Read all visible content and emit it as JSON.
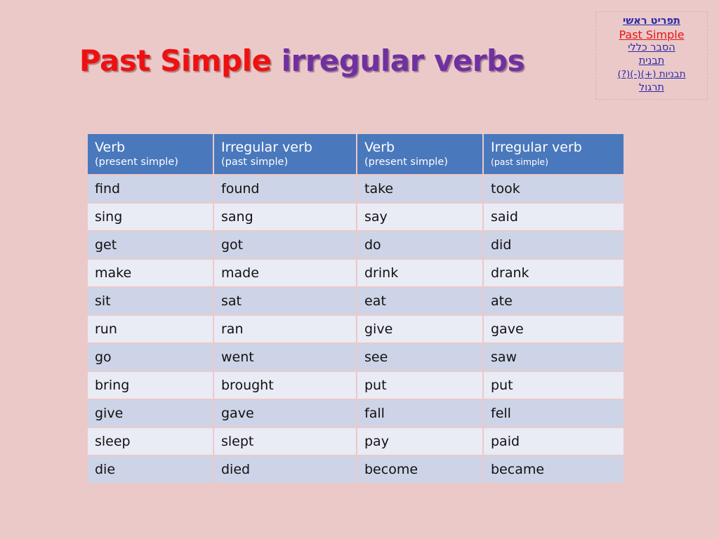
{
  "slide": {
    "background_color": "#ebc9c9"
  },
  "title": {
    "part1": "Past Simple",
    "part1_color": "#ee1111",
    "part2": "irregular verbs",
    "part2_color": "#7030a0"
  },
  "nav_menu": {
    "items": [
      {
        "label": "תפריט ראשי",
        "style": "navy"
      },
      {
        "label": "Past Simple",
        "style": "red"
      },
      {
        "label": "הסבר כללי",
        "style": "blue"
      },
      {
        "label": "תבנית",
        "style": "blue"
      },
      {
        "label": "תבניות (+)(-)(?)",
        "style": "blue"
      },
      {
        "label": "תרגול",
        "style": "blue"
      }
    ]
  },
  "table": {
    "header_color": "#4a78bc",
    "row_dark_color": "#ced4e7",
    "row_light_color": "#e9ebf5",
    "columns": [
      {
        "main": "Verb",
        "sub": "(present simple)"
      },
      {
        "main": "Irregular verb",
        "sub": "(past simple)"
      },
      {
        "main": "Verb",
        "sub": "(present simple)"
      },
      {
        "main": "Irregular verb",
        "sub": "(past simple)"
      }
    ],
    "rows": [
      [
        "find",
        "found",
        "take",
        "took"
      ],
      [
        "sing",
        "sang",
        "say",
        "said"
      ],
      [
        "get",
        "got",
        "do",
        "did"
      ],
      [
        "make",
        "made",
        "drink",
        "drank"
      ],
      [
        "sit",
        "sat",
        "eat",
        "ate"
      ],
      [
        "run",
        "ran",
        "give",
        "gave"
      ],
      [
        "go",
        "went",
        "see",
        "saw"
      ],
      [
        "bring",
        "brought",
        "put",
        "put"
      ],
      [
        "give",
        "gave",
        "fall",
        "fell"
      ],
      [
        "sleep",
        "slept",
        "pay",
        "paid"
      ],
      [
        "die",
        "died",
        "become",
        "became"
      ]
    ]
  }
}
